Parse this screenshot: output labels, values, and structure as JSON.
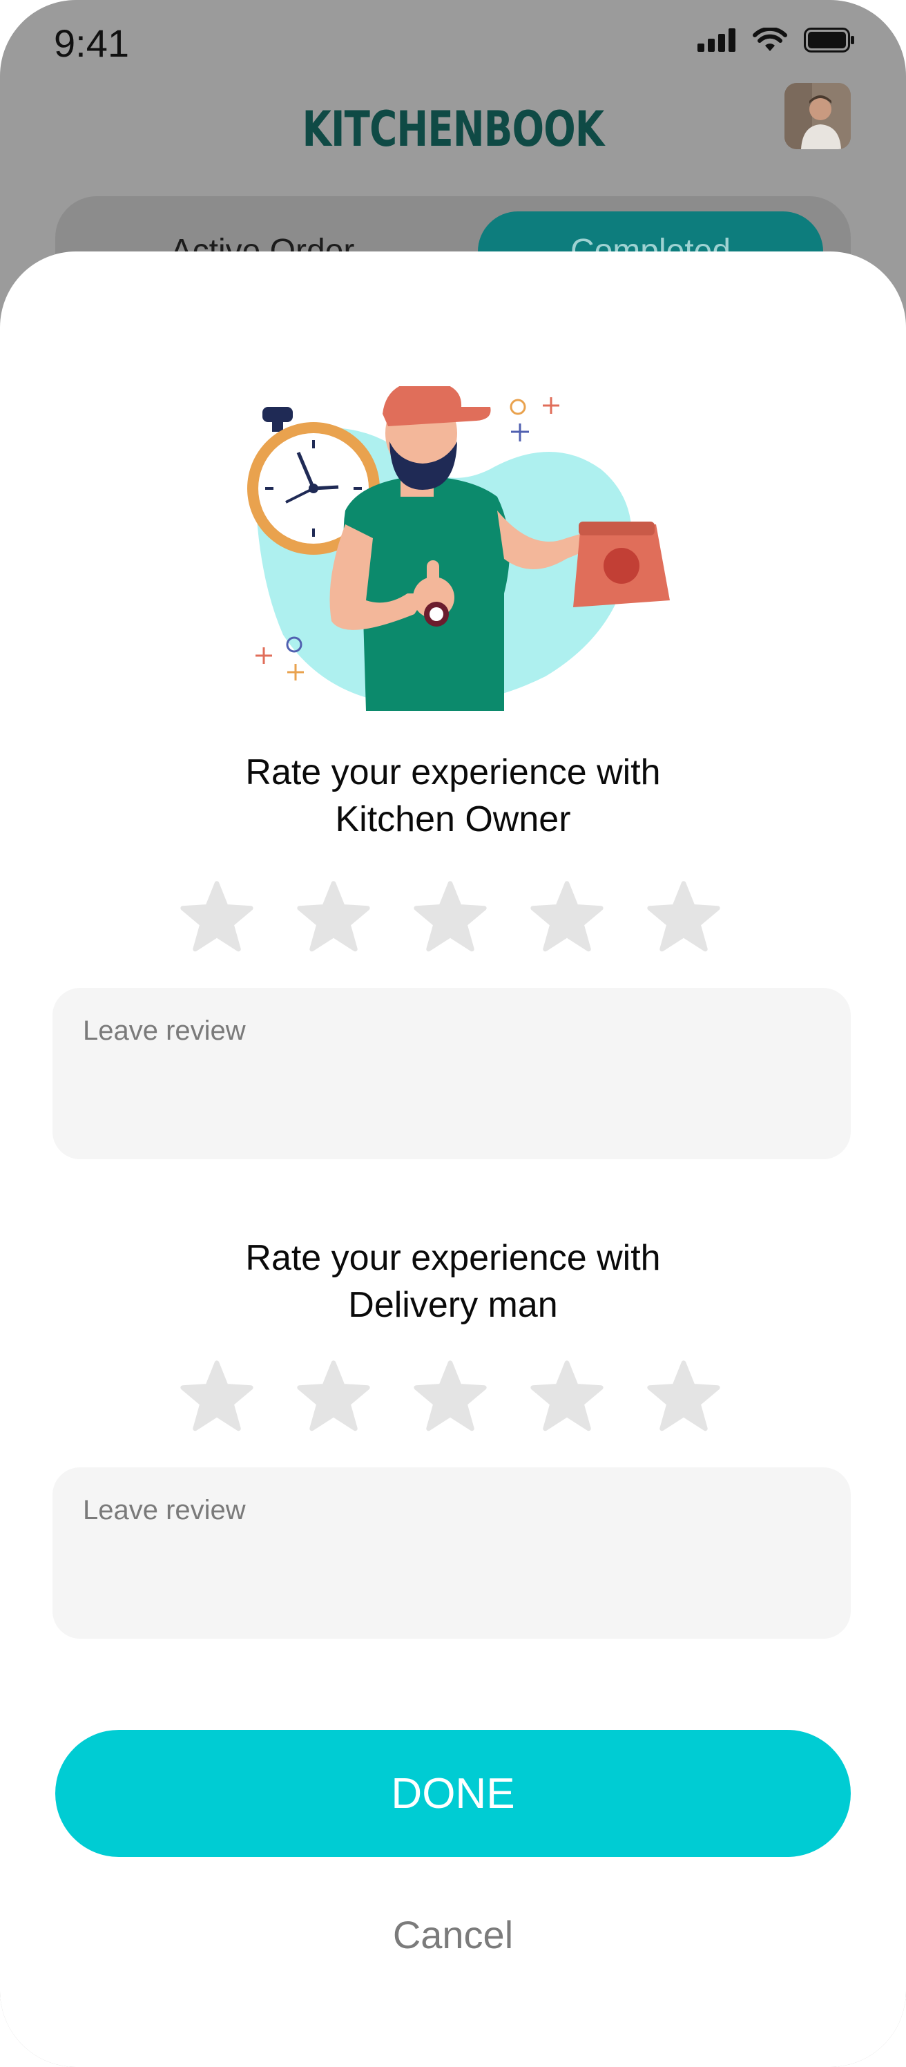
{
  "status_bar": {
    "time": "9:41"
  },
  "header": {
    "title": "KITCHENBOOK"
  },
  "tabs": [
    {
      "label": "Active Order",
      "selected": false
    },
    {
      "label": "Completed",
      "selected": true
    }
  ],
  "rating_sheet": {
    "kitchen": {
      "prompt_line1": "Rate your experience with",
      "prompt_line2": "Kitchen Owner",
      "rating": 0,
      "max_rating": 5,
      "review_placeholder": "Leave review"
    },
    "delivery": {
      "prompt_line1": "Rate your experience with",
      "prompt_line2": "Delivery man",
      "rating": 0,
      "max_rating": 5,
      "review_placeholder": "Leave review"
    },
    "done_label": "DONE",
    "cancel_label": "Cancel"
  },
  "colors": {
    "accent": "#00ccd3",
    "brand_dark": "#0f4a45",
    "star_empty": "#e4e4e4",
    "input_bg": "#f5f5f5"
  },
  "icons": {
    "star": "star-icon",
    "signal": "cellular-signal-icon",
    "wifi": "wifi-icon",
    "battery": "battery-icon"
  }
}
